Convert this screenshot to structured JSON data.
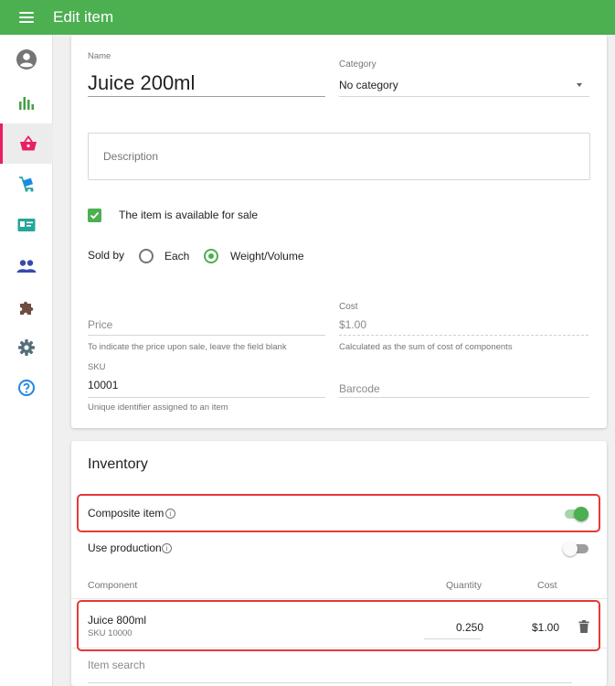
{
  "app": {
    "title": "Edit item"
  },
  "sidebar": {
    "items": [
      {
        "icon": "account-circle-icon"
      },
      {
        "icon": "bar-chart-icon"
      },
      {
        "icon": "basket-icon",
        "active": true
      },
      {
        "icon": "inventory-cart-icon"
      },
      {
        "icon": "id-card-icon"
      },
      {
        "icon": "people-icon"
      },
      {
        "icon": "puzzle-icon"
      },
      {
        "icon": "gear-icon"
      },
      {
        "icon": "help-icon"
      }
    ]
  },
  "item": {
    "name_label": "Name",
    "name_value": "Juice 200ml",
    "category_label": "Category",
    "category_value": "No category",
    "description_placeholder": "Description",
    "available_label": "The item is available for sale",
    "available_checked": true,
    "sold_by_label": "Sold by",
    "sold_by_options": [
      {
        "label": "Each",
        "selected": false
      },
      {
        "label": "Weight/Volume",
        "selected": true
      }
    ],
    "price_placeholder": "Price",
    "price_hint": "To indicate the price upon sale, leave the field blank",
    "cost_label": "Cost",
    "cost_value": "$1.00",
    "cost_hint": "Calculated as the sum of cost of components",
    "sku_label": "SKU",
    "sku_value": "10001",
    "sku_hint": "Unique identifier assigned to an item",
    "barcode_placeholder": "Barcode"
  },
  "inventory": {
    "title": "Inventory",
    "composite_label": "Composite item",
    "composite_on": true,
    "production_label": "Use production",
    "production_on": false,
    "columns": {
      "component": "Component",
      "quantity": "Quantity",
      "cost": "Cost"
    },
    "components": [
      {
        "name": "Juice 800ml",
        "sku": "SKU 10000",
        "quantity": "0.250",
        "cost": "$1.00"
      }
    ],
    "search_placeholder": "Item search",
    "info_glyph": "i"
  },
  "colors": {
    "brand": "#4caf50",
    "active_accent": "#e91e63",
    "highlight": "#e53935",
    "icon_green": "#43a047",
    "icon_pink": "#e91e63",
    "icon_blue": "#1e88e5",
    "icon_teal": "#26a69a",
    "icon_brown": "#6d4c41",
    "icon_slate": "#546e7a"
  }
}
